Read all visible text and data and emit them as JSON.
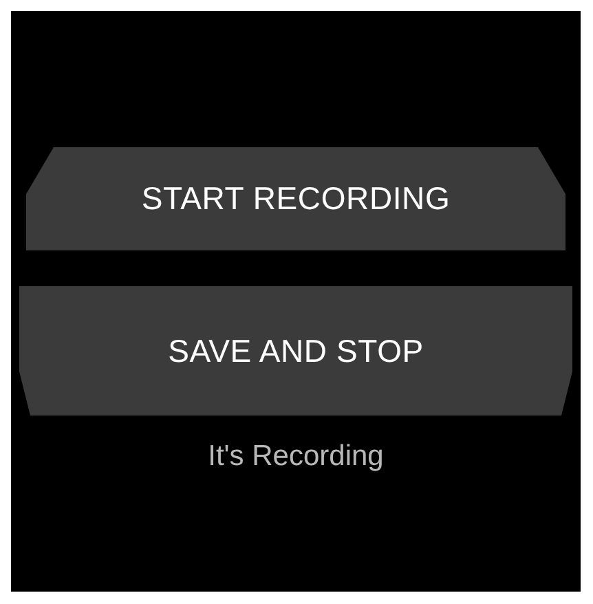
{
  "buttons": [
    {
      "label": "START RECORDING"
    },
    {
      "label": "SAVE AND STOP"
    }
  ],
  "status": "It's Recording"
}
